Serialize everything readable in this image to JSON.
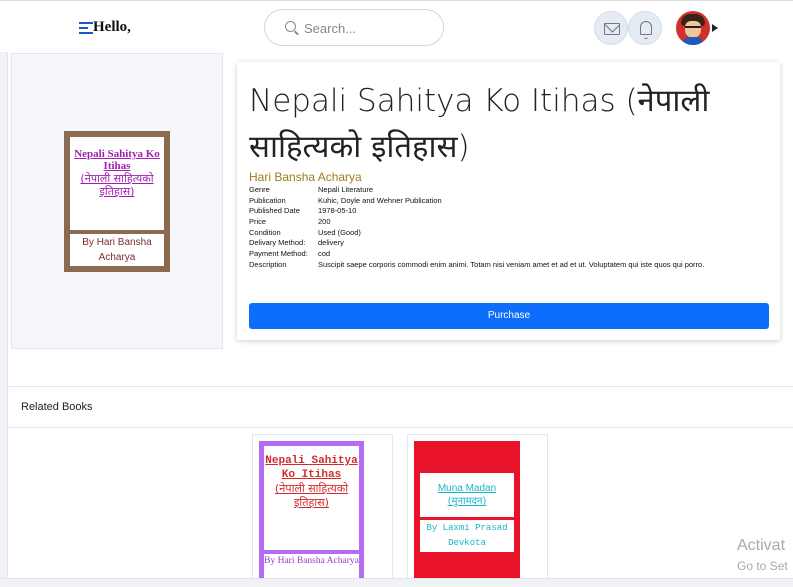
{
  "header": {
    "greeting": "Hello,",
    "search_placeholder": "Search..."
  },
  "book": {
    "cover_title": "Nepali Sahitya Ko Itihas",
    "cover_title_nepali": "(नेपाली साहित्यको इतिहास)",
    "cover_author": "By Hari Bansha Acharya",
    "title": "Nepali Sahitya Ko Itihas (नेपाली साहित्यको इतिहास)",
    "author": "Hari Bansha Acharya",
    "specs": [
      {
        "key": "Genre",
        "value": "Nepali Literature"
      },
      {
        "key": "Publication",
        "value": "Kuhic, Doyle and Wehner Publication"
      },
      {
        "key": "Published Date",
        "value": "1978-05-10"
      },
      {
        "key": "Price",
        "value": "200"
      },
      {
        "key": "Condition",
        "value": "Used (Good)"
      },
      {
        "key": "Delivary Method:",
        "value": "delivery"
      },
      {
        "key": "Payment Method:",
        "value": "cod"
      },
      {
        "key": "Description",
        "value": "Suscipit saepe corporis commodi enim animi. Totam nisi veniam amet et ad et ut. Voluptatem qui iste quos qui porro."
      }
    ],
    "purchase_label": "Purchase"
  },
  "related": {
    "heading": "Related Books",
    "books": [
      {
        "title": "Nepali Sahitya Ko Itihas",
        "title_nepali": "(नेपाली साहित्यको इतिहास)",
        "author": "By Hari Bansha Acharya"
      },
      {
        "title": "Muna Madan",
        "title_nepali": "(मुनामदन)",
        "author": "By Laxmi Prasad Devkota"
      }
    ]
  },
  "watermark": {
    "line1": "Activat",
    "line2": "Go to Set"
  },
  "colors": {
    "primary_button": "#0d6efd",
    "cover1_frame": "#8c6a4f",
    "related1_frame": "#b46cf2",
    "related2_frame": "#e8132a",
    "author_color": "#a07d1c"
  }
}
